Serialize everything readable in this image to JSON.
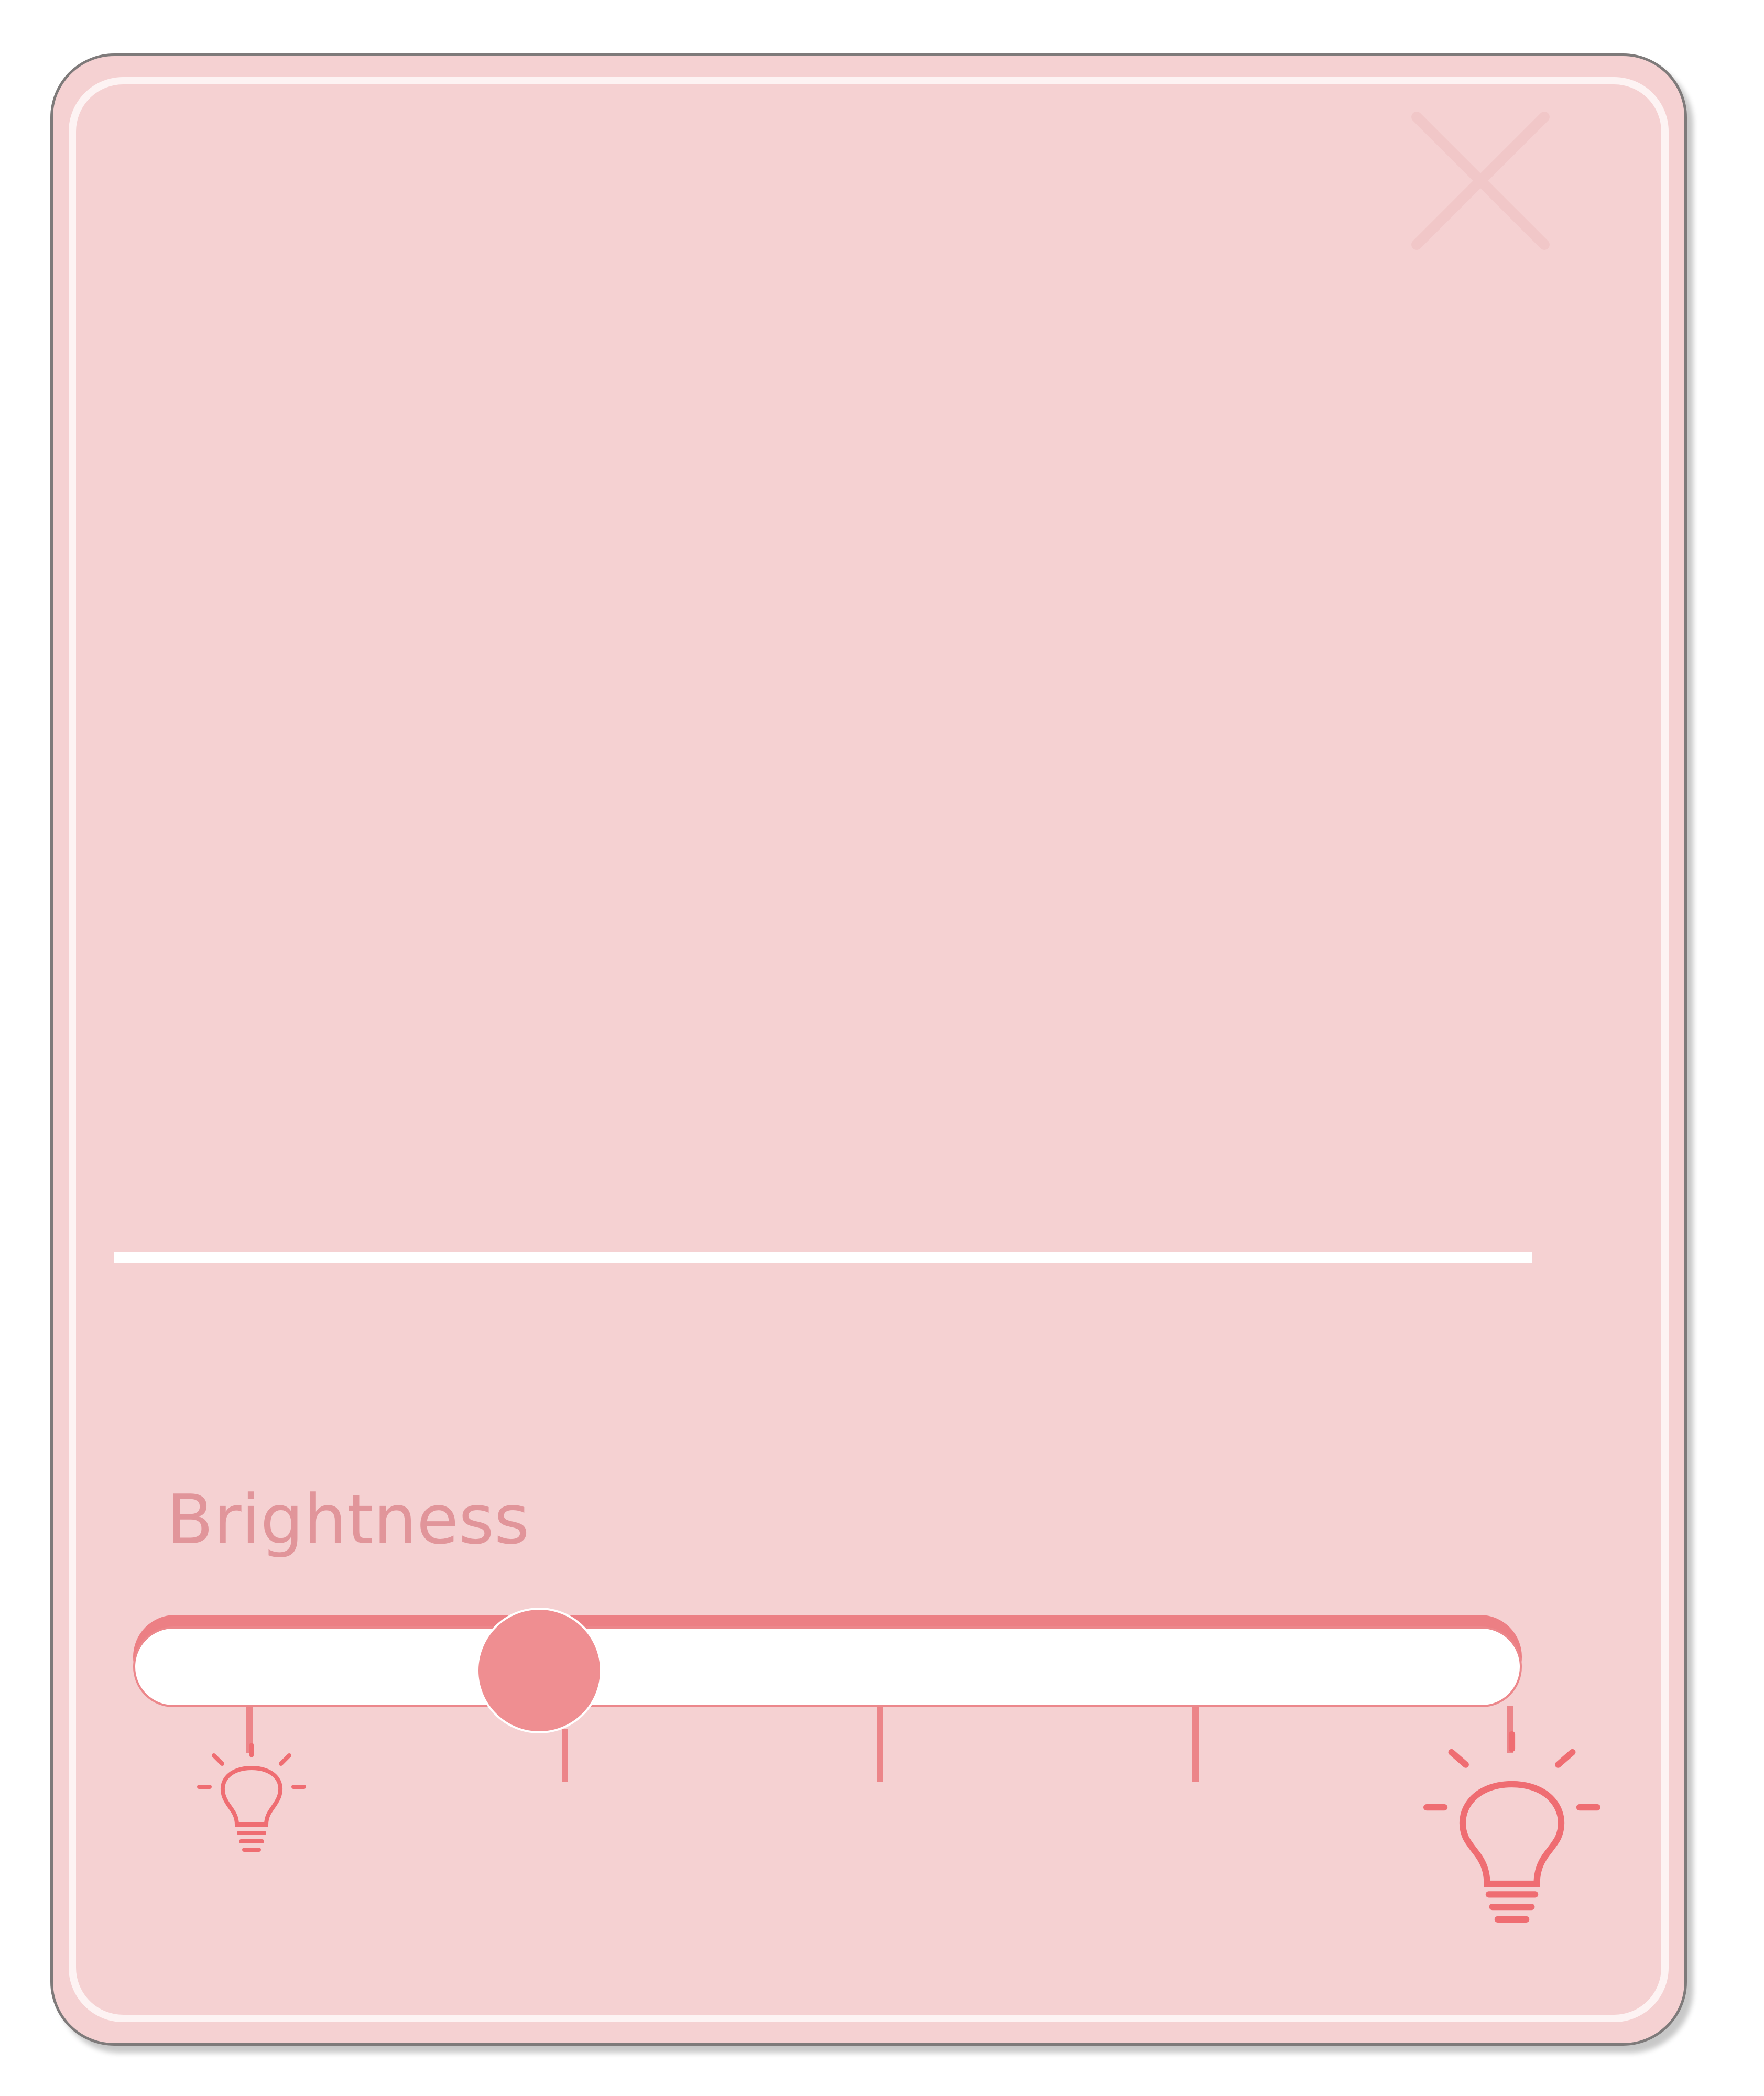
{
  "brightness": {
    "label": "Brightness",
    "level_fraction": 0.23,
    "tick_count": 5,
    "min_icon": "lightbulb-dim-icon",
    "max_icon": "lightbulb-bright-icon"
  },
  "controls": {
    "close_icon": "close-icon"
  },
  "colors": {
    "panel_background": "#f5d1d2",
    "accent": "#ec7f84",
    "thumb": "#ef8e91",
    "label_text": "#e1959a",
    "icon": "#ef6d72"
  }
}
